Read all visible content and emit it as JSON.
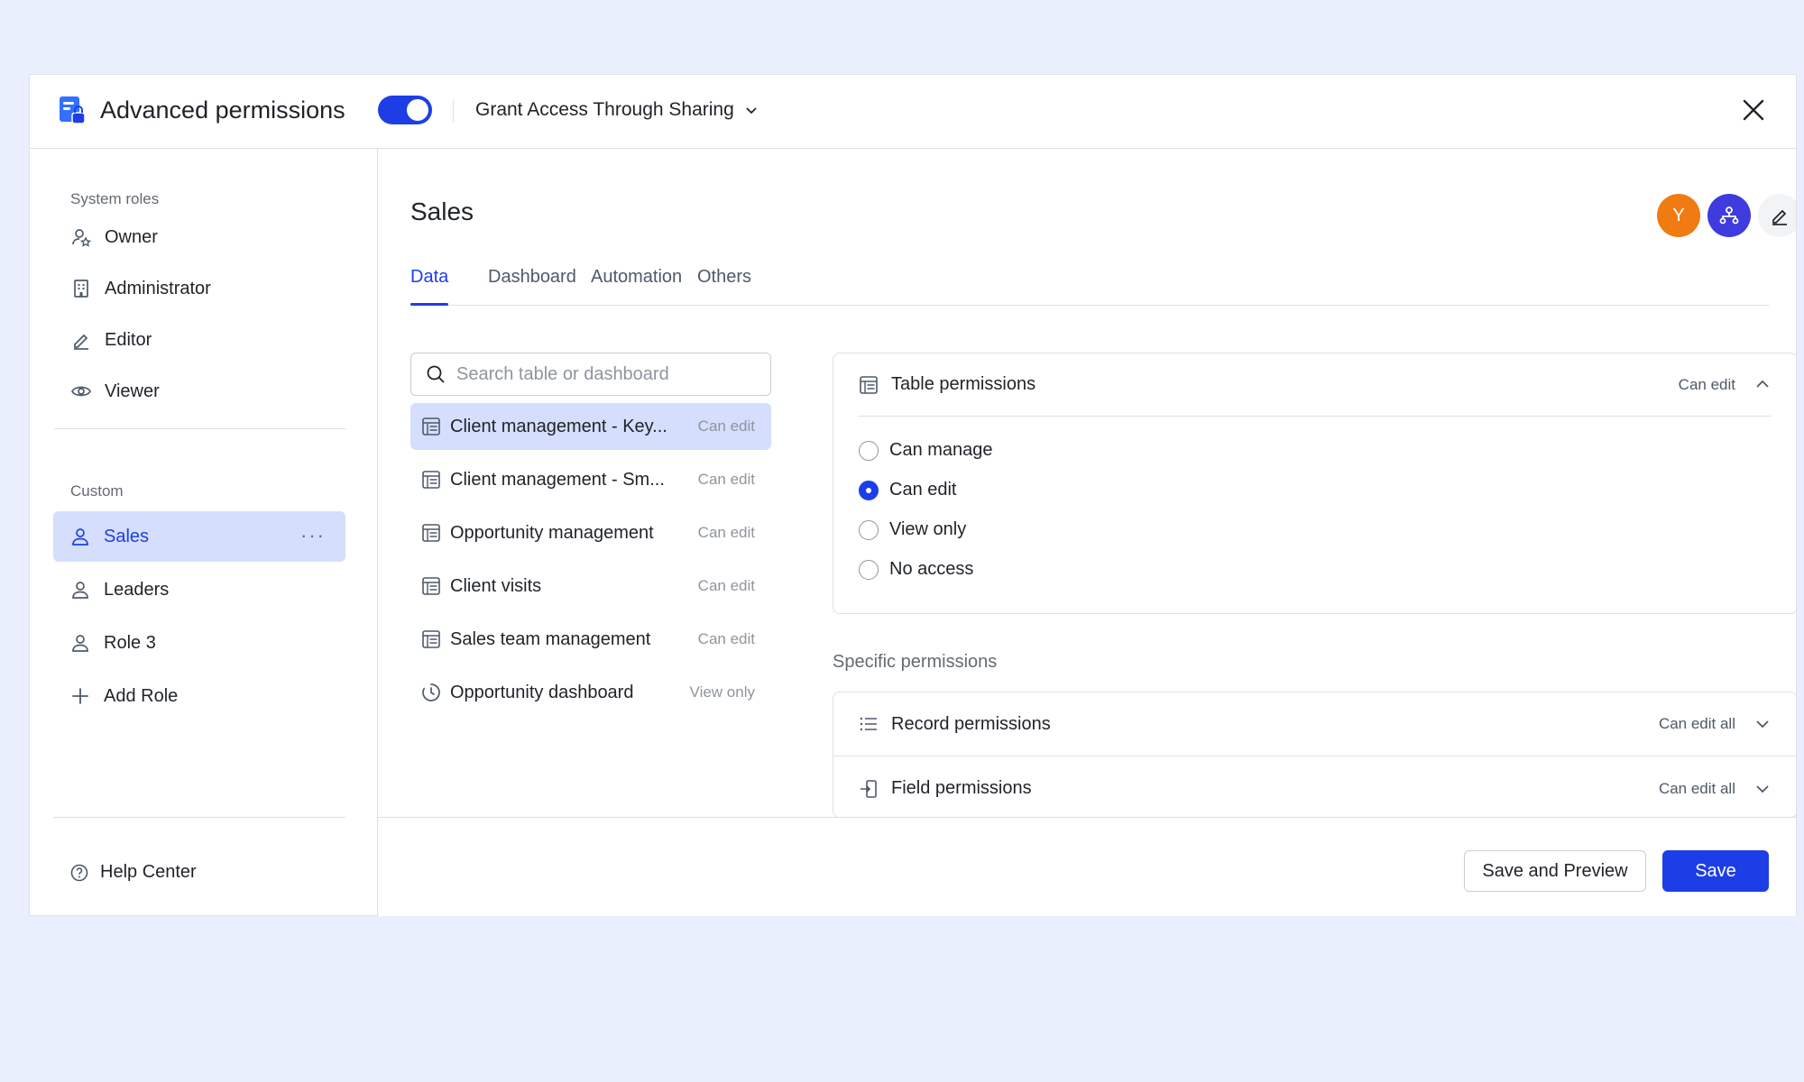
{
  "header": {
    "title": "Advanced permissions",
    "toggle_on": true,
    "sharing_label": "Grant Access Through Sharing"
  },
  "sidebar": {
    "system_label": "System roles",
    "system_roles": [
      {
        "label": "Owner",
        "icon": "owner-icon"
      },
      {
        "label": "Administrator",
        "icon": "building-icon"
      },
      {
        "label": "Editor",
        "icon": "pencil-icon"
      },
      {
        "label": "Viewer",
        "icon": "eye-icon"
      }
    ],
    "custom_label": "Custom",
    "custom_roles": [
      {
        "label": "Sales",
        "icon": "user-icon",
        "active": true,
        "more": "···"
      },
      {
        "label": "Leaders",
        "icon": "user-icon"
      },
      {
        "label": "Role 3",
        "icon": "user-icon"
      }
    ],
    "add_role": "Add Role",
    "help": "Help Center"
  },
  "main": {
    "role_title": "Sales",
    "avatar_initial": "Y",
    "tabs": [
      "Data",
      "Dashboard",
      "Automation",
      "Others"
    ],
    "active_tab": "Data",
    "search_placeholder": "Search table or dashboard",
    "tables": [
      {
        "name": "Client management - Key...",
        "perm": "Can edit",
        "icon": "table-icon",
        "active": true
      },
      {
        "name": "Client management - Sm...",
        "perm": "Can edit",
        "icon": "table-icon"
      },
      {
        "name": "Opportunity management",
        "perm": "Can edit",
        "icon": "table-icon"
      },
      {
        "name": "Client visits",
        "perm": "Can edit",
        "icon": "table-icon"
      },
      {
        "name": "Sales team management",
        "perm": "Can edit",
        "icon": "table-icon"
      },
      {
        "name": "Opportunity dashboard",
        "perm": "View only",
        "icon": "dashboard-icon"
      }
    ],
    "table_permissions": {
      "title": "Table permissions",
      "value": "Can edit",
      "options": [
        "Can manage",
        "Can edit",
        "View only",
        "No access"
      ],
      "selected": "Can edit"
    },
    "specific_label": "Specific permissions",
    "specific": [
      {
        "title": "Record permissions",
        "value": "Can edit all",
        "icon": "list-icon"
      },
      {
        "title": "Field permissions",
        "value": "Can edit all",
        "icon": "field-icon"
      }
    ]
  },
  "footer": {
    "save_preview": "Save and Preview",
    "save": "Save"
  },
  "colors": {
    "accent": "#1d3ee6",
    "selected_bg": "#d5defc",
    "avatar_orange": "#f07b12",
    "avatar_purple": "#3f3bdd",
    "background": "#e9effd"
  }
}
